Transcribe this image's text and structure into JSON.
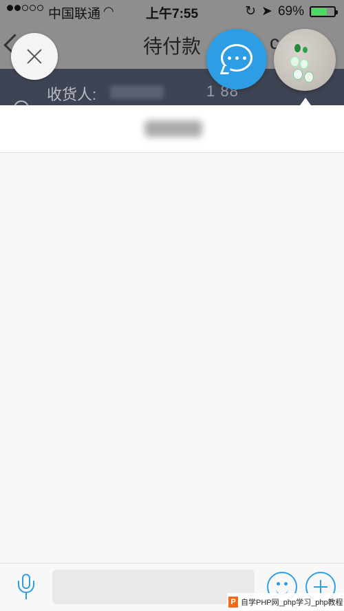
{
  "status_bar": {
    "carrier": "中国联通",
    "time": "上午7:55",
    "battery_text": "69%",
    "battery_level": 0.69,
    "battery_color": "#4cd964",
    "icons": [
      "wifi-icon",
      "rotation-lock-icon",
      "location-arrow-icon",
      "battery-icon"
    ]
  },
  "background_page": {
    "title": "待付款",
    "right_char": "с",
    "recipient_label": "收货人:",
    "phone_partial": "1          88"
  },
  "floating_buttons": {
    "close": "close-icon",
    "chat": "chat-bubble-icon",
    "avatar": "product-avatar"
  },
  "colors": {
    "accent": "#2d9ee3",
    "dim_header": "#3e4453",
    "panel_bg": "#f7f7f7"
  },
  "input_bar": {
    "placeholder": "",
    "icons": [
      "microphone-icon",
      "emoji-icon",
      "plus-icon"
    ]
  },
  "watermark": {
    "logo": "P",
    "text": "自学PHP网_php学习_php教程"
  }
}
